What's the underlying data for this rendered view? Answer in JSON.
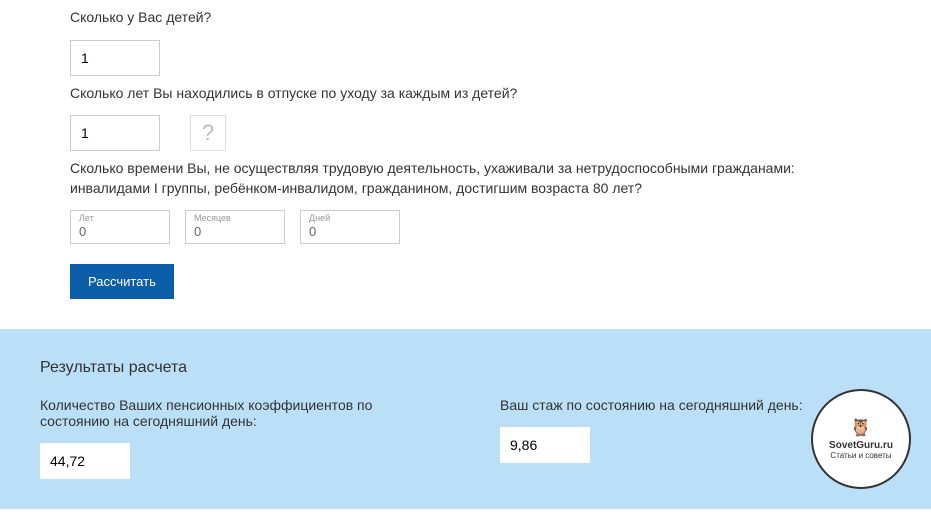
{
  "q1": {
    "label": "Сколько у Вас детей?",
    "value": "1"
  },
  "q2": {
    "label": "Сколько лет Вы находились в отпуске по уходу за каждым из детей?",
    "value": "1"
  },
  "help_label": "?",
  "q3": {
    "label": "Сколько времени Вы, не осуществляя трудовую деятельность, ухаживали за нетрудоспособными гражданами: инвалидами I группы, ребёнком-инвалидом, гражданином, достигшим возраста 80 лет?",
    "years": {
      "label": "Лет",
      "value": "0"
    },
    "months": {
      "label": "Месяцев",
      "value": "0"
    },
    "days": {
      "label": "Дней",
      "value": "0"
    }
  },
  "calc_btn": "Рассчитать",
  "results": {
    "title": "Результаты расчета",
    "coef": {
      "label": "Количество Ваших пенсионных коэффициентов по состоянию на сегодняшний день:",
      "value": "44,72"
    },
    "stazh": {
      "label": "Ваш стаж по состоянию на сегодняшний день:",
      "value": "9,86"
    }
  },
  "stamp": {
    "line1": "SovetGuru.ru",
    "line2": "Статьи и советы"
  }
}
